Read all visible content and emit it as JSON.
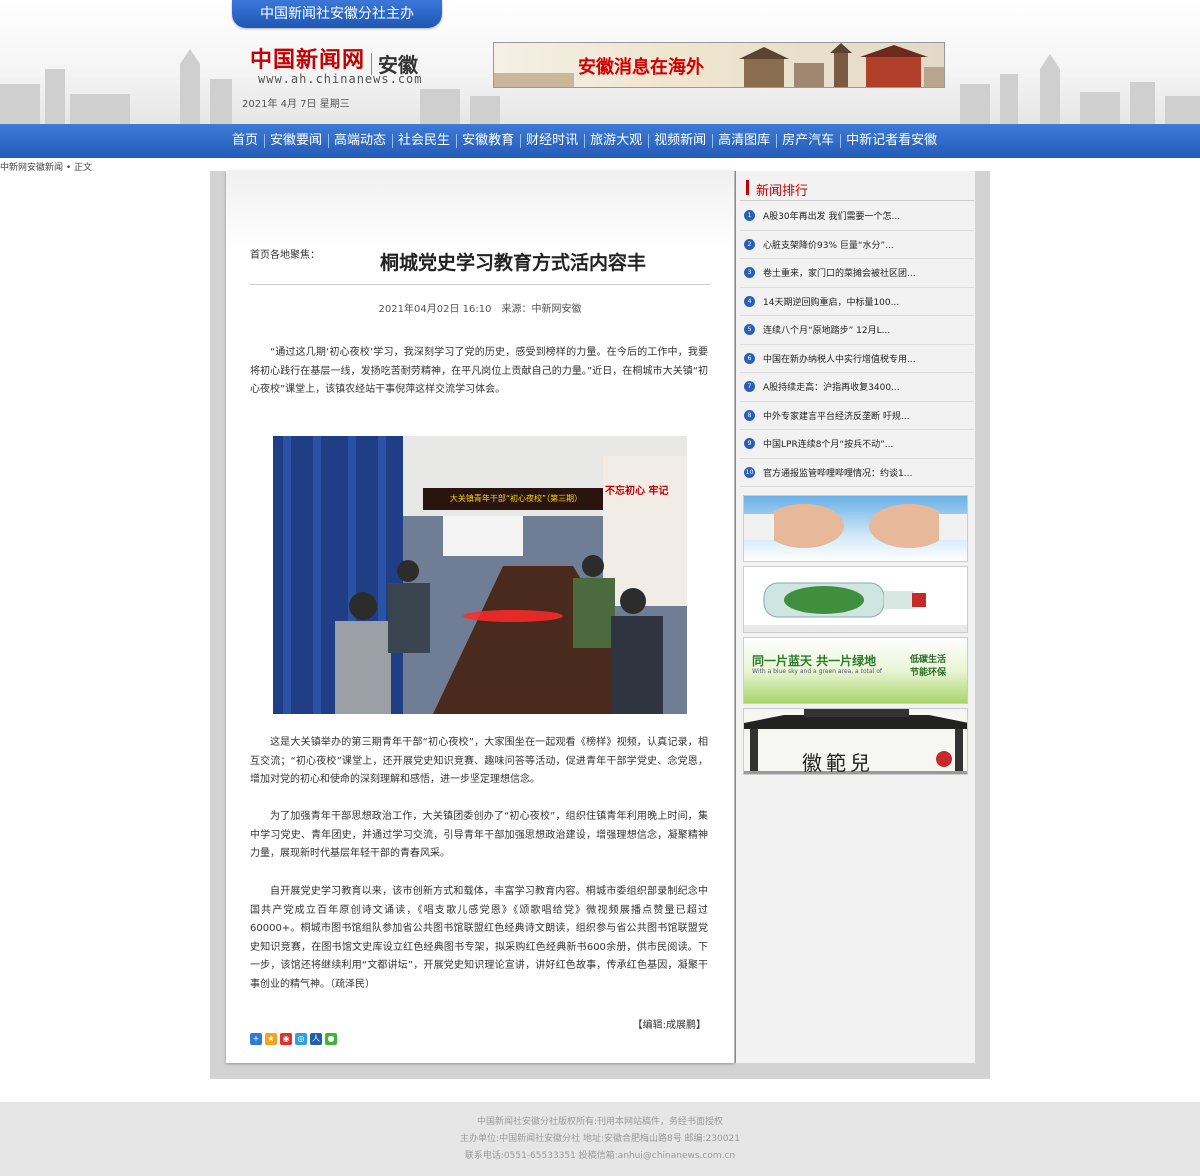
{
  "header": {
    "top_tab": "中国新闻社安徽分社主办",
    "logo_main": "中国新闻网",
    "logo_region": "安徽",
    "url": "www.ah.chinanews.com",
    "date": "2021年 4月 7日   星期三",
    "banner_text": "安徽消息在海外"
  },
  "nav": {
    "items": [
      "首页",
      "安徽要闻",
      "高端动态",
      "社会民生",
      "安徽教育",
      "财经时讯",
      "旅游大观",
      "视频新闻",
      "高清图库",
      "房产汽车",
      "中新记者看安徽"
    ]
  },
  "breadcrumb": "中新网安徽新闻 • 正文",
  "article": {
    "column_label": "首页各地聚焦：",
    "title": "桐城党史学习教育方式活内容丰",
    "datetime": "2021年04月02日 16:10",
    "source": "来源：中新网安徽",
    "paragraphs": [
      "“通过这几期‘初心夜校’学习，我深刻学习了党的历史，感受到榜样的力量。在今后的工作中，我要将初心践行在基层一线，发扬吃苦耐劳精神，在平凡岗位上贡献自己的力量。”近日，在桐城市大关镇“初心夜校”课堂上，该镇农经站干事倪萍这样交流学习体会。",
      "这是大关镇举办的第三期青年干部“初心夜校”，大家围坐在一起观看《榜样》视频，认真记录，相互交流；“初心夜校”课堂上，还开展党史知识竞赛、趣味问答等活动，促进青年干部学党史、念党恩，增加对党的初心和使命的深刻理解和感悟，进一步坚定理想信念。",
      "为了加强青年干部思想政治工作，大关镇团委创办了“初心夜校”，组织住镇青年利用晚上时间，集中学习党史、青年团史，并通过学习交流，引导青年干部加强思想政治建设，增强理想信念，凝聚精神力量，展现新时代基层年轻干部的青春风采。",
      "自开展党史学习教育以来，该市创新方式和载体，丰富学习教育内容。桐城市委组织部录制纪念中国共产党成立百年原创诗文诵读，《唱支歌儿感党恩》《颂歌唱给党》微视频展播点赞量已超过60000+。桐城市图书馆组队参加省公共图书馆联盟红色经典诗文朗读，组织参与省公共图书馆联盟党史知识竞赛，在图书馆文史库设立红色经典图书专架，拟采购红色经典新书600余册，供市民阅读。下一步，该馆还将继续利用“文都讲坛”，开展党史知识理论宣讲，讲好红色故事，传承红色基因，凝聚干事创业的精气神。（疏泽民）"
    ],
    "photo_banner": "大关镇青年干部“初心夜校”（第三期）",
    "photo_wall_text": "不忘初心 牢记",
    "editor": "【编辑:成展鹏】",
    "share_icons": [
      "share-plus-icon",
      "qzone-icon",
      "weibo-icon",
      "tencent-weibo-icon",
      "renren-icon",
      "wechat-icon"
    ]
  },
  "sidebar": {
    "rank_title": "新闻排行",
    "rank_items": [
      {
        "num": "1",
        "text": "A股30年再出发 我们需要一个怎..."
      },
      {
        "num": "2",
        "text": "心脏支架降价93% 巨量“水分”..."
      },
      {
        "num": "3",
        "text": "卷土重来，家门口的菜摊会被社区团..."
      },
      {
        "num": "4",
        "text": "14天期逆回购重启，中标量100..."
      },
      {
        "num": "5",
        "text": "连续八个月“原地踏步” 12月L..."
      },
      {
        "num": "6",
        "text": "中国在新办纳税人中实行增值税专用..."
      },
      {
        "num": "7",
        "text": "A股持续走高：沪指再收复3400..."
      },
      {
        "num": "8",
        "text": "中外专家建言平台经济反垄断 吁规..."
      },
      {
        "num": "9",
        "text": "中国LPR连续8个月“按兵不动”..."
      },
      {
        "num": "10",
        "text": "官方通报监管哔哩哔哩情况：约谈1..."
      }
    ],
    "ad3_main": "同一片蓝天 共一片绿地",
    "ad3_sub": "With a blue sky and a green area, a total of",
    "ad3_right1": "低碳生活",
    "ad3_right2": "节能环保",
    "ad4_text": "徽範兒"
  },
  "footer": {
    "line1": "中国新闻社安徽分社版权所有:刊用本网站稿件，务经书面授权",
    "line2": "主办单位:中国新闻社安徽分社 地址:安徽合肥梅山路8号 邮编:230021",
    "line3": "联系电话:0551-65533351      投稿信箱:anhui@chinanews.com.cn"
  },
  "colors": {
    "brand_blue": "#245cb8",
    "brand_red": "#c00000"
  }
}
